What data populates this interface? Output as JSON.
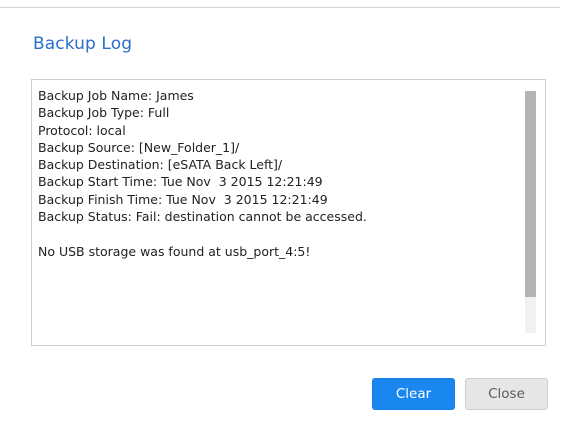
{
  "dialog": {
    "title": "Backup Log"
  },
  "log": {
    "lines": [
      "Backup Job Name: James",
      "Backup Job Type: Full",
      "Protocol: local",
      "Backup Source: [New_Folder_1]/",
      "Backup Destination: [eSATA Back Left]/",
      "Backup Start Time: Tue Nov  3 2015 12:21:49",
      "Backup Finish Time: Tue Nov  3 2015 12:21:49",
      "Backup Status: Fail: destination cannot be accessed.",
      "",
      "No USB storage was found at usb_port_4:5!"
    ]
  },
  "buttons": {
    "clear_label": "Clear",
    "close_label": "Close"
  },
  "colors": {
    "title": "#2a6fc9",
    "primary_button": "#1a87f0",
    "secondary_button": "#e6e6e6"
  }
}
